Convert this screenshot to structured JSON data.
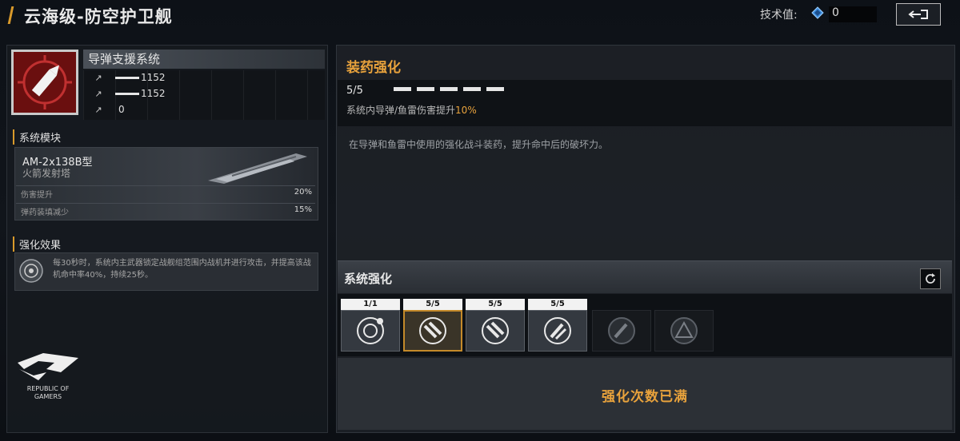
{
  "header": {
    "title": "云海级-防空护卫舰",
    "tech_label": "技术值:",
    "tech_value": "0",
    "back_icon": "return-arrow-icon"
  },
  "left": {
    "weapon_name": "导弹支援系统",
    "weapon_icon": "missile-icon",
    "stats": [
      {
        "icon": "damage-icon",
        "value": "1152"
      },
      {
        "icon": "damage-icon",
        "value": "1152"
      },
      {
        "icon": "damage-icon",
        "value": "0"
      }
    ],
    "module_section": "系统模块",
    "module": {
      "name": "AM-2x138B型",
      "subtitle": "火箭发射塔",
      "rows": [
        {
          "label": "伤害提升",
          "value": "20%"
        },
        {
          "label": "弹药装填减少",
          "value": "15%"
        }
      ]
    },
    "effect_section": "强化效果",
    "effect_text": "每30秒时，系统内主武器锁定战舰组范围内战机并进行攻击，并提高该战机命中率40%，持续25秒。",
    "logo_text": "REPUBLIC OF GAMERS"
  },
  "right": {
    "upgrade_title": "装药强化",
    "level": "5/5",
    "level_segments": 5,
    "level_fill": 5,
    "bonus_prefix": "系统内导弹/鱼雷伤害提升",
    "bonus_value": "10%",
    "description": "在导弹和鱼雷中使用的强化战斗装药，提升命中后的破坏力。",
    "system_title": "系统强化",
    "refresh_icon": "refresh-icon",
    "nodes": [
      {
        "tag": "1/1",
        "icon": "orbit-icon",
        "state": "normal"
      },
      {
        "tag": "5/5",
        "icon": "missiles-icon",
        "state": "selected"
      },
      {
        "tag": "5/5",
        "icon": "missiles-icon",
        "state": "normal"
      },
      {
        "tag": "5/5",
        "icon": "rocket-burst-icon",
        "state": "normal"
      },
      {
        "tag": "",
        "icon": "rocket-burst-icon",
        "state": "locked"
      },
      {
        "tag": "",
        "icon": "shield-triangle-icon",
        "state": "locked"
      }
    ],
    "full_text": "强化次数已满"
  },
  "colors": {
    "accent": "#e8a23c",
    "weapon_bg": "#6a0f0f"
  }
}
